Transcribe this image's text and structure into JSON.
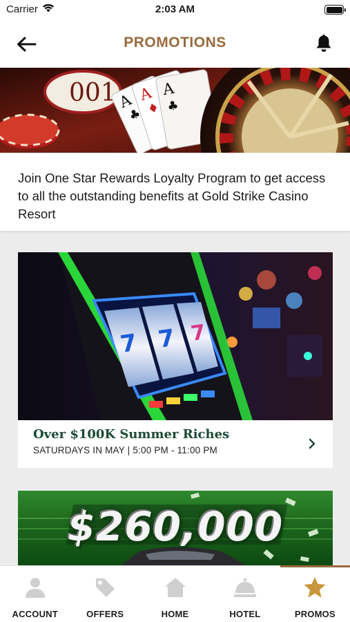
{
  "status_bar": {
    "carrier": "Carrier",
    "time": "2:03 AM",
    "wifi_icon": "wifi-icon",
    "battery_icon": "battery-icon"
  },
  "header": {
    "title": "PROMOTIONS",
    "back_icon": "arrow-left-icon",
    "bell_icon": "bell-icon",
    "title_color": "#9a6a3c"
  },
  "hero": {
    "description": "Join One Star Rewards Loyalty Program to get access to all the outstanding benefits at Gold Strike Casino Resort"
  },
  "promos": [
    {
      "title": "Over $100K Summer Riches",
      "subtitle": "SATURDAYS IN MAY | 5:00 PM - 11:00 PM"
    },
    {
      "image_text": "$260,000"
    }
  ],
  "tab_bar": {
    "tabs": [
      {
        "label": "ACCOUNT",
        "icon": "person-icon"
      },
      {
        "label": "OFFERS",
        "icon": "tag-icon"
      },
      {
        "label": "HOME",
        "icon": "home-icon"
      },
      {
        "label": "HOTEL",
        "icon": "service-bell-icon"
      },
      {
        "label": "PROMOS",
        "icon": "star-icon"
      }
    ],
    "active_index": 4,
    "active_color": "#c8963c",
    "inactive_color": "#cfcfcf"
  },
  "colors": {
    "brand_brown": "#9a6a3c",
    "promo_title_green": "#1c4a36",
    "background": "#ececec"
  }
}
